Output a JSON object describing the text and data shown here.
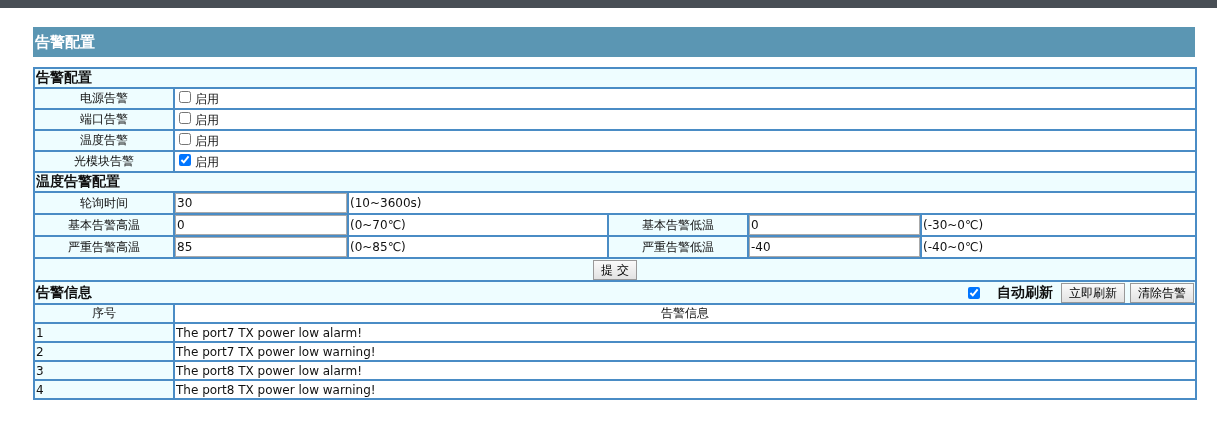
{
  "page_title": "告警配置",
  "alarm_section": {
    "title": "告警配置",
    "items": [
      {
        "label": "电源告警",
        "option": "启用",
        "checked": false
      },
      {
        "label": "端口告警",
        "option": "启用",
        "checked": false
      },
      {
        "label": "温度告警",
        "option": "启用",
        "checked": false
      },
      {
        "label": "光模块告警",
        "option": "启用",
        "checked": true
      }
    ]
  },
  "temp_section": {
    "title": "温度告警配置",
    "poll": {
      "label": "轮询时间",
      "value": "30",
      "range": "(10~3600s)"
    },
    "rows": [
      {
        "left": {
          "label": "基本告警高温",
          "value": "0",
          "range": "(0~70℃)"
        },
        "right": {
          "label": "基本告警低温",
          "value": "0",
          "range": "(-30~0℃)"
        }
      },
      {
        "left": {
          "label": "严重告警高温",
          "value": "85",
          "range": "(0~85℃)"
        },
        "right": {
          "label": "严重告警低温",
          "value": "-40",
          "range": "(-40~0℃)"
        }
      }
    ]
  },
  "submit_button": "提 交",
  "info_section": {
    "title": "告警信息",
    "auto_refresh": {
      "label": "自动刷新",
      "checked": true
    },
    "buttons": [
      "立即刷新",
      "清除告警"
    ],
    "columns": [
      "序号",
      "告警信息"
    ],
    "rows": [
      {
        "index": "1",
        "message": "The port7 TX power low alarm!"
      },
      {
        "index": "2",
        "message": "The port7 TX power low warning!"
      },
      {
        "index": "3",
        "message": "The port8 TX power low alarm!"
      },
      {
        "index": "4",
        "message": "The port8 TX power low warning!"
      }
    ]
  }
}
